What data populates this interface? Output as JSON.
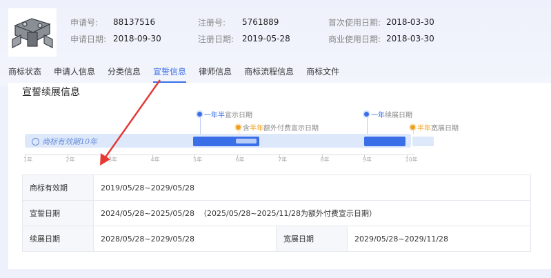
{
  "header": {
    "meta": [
      [
        {
          "k": "申请号:",
          "v": "88137516"
        },
        {
          "k": "申请日期:",
          "v": "2018-09-30"
        }
      ],
      [
        {
          "k": "注册号:",
          "v": "5761889"
        },
        {
          "k": "注册日期:",
          "v": "2019-05-28"
        }
      ],
      [
        {
          "k": "首次使用日期:",
          "v": "2018-03-30"
        },
        {
          "k": "商业使用日期:",
          "v": "2018-03-30"
        }
      ]
    ]
  },
  "tabs": [
    "商标状态",
    "申请人信息",
    "分类信息",
    "宣誓信息",
    "律师信息",
    "商标流程信息",
    "商标文件"
  ],
  "active_tab": "宣誓信息",
  "section_title": "宣誓续展信息",
  "timeline": {
    "track_label": "商标有效期10年",
    "annotations": {
      "a1_hl": "一年半",
      "a1_rest": "宣示日期",
      "a2_pre": "含",
      "a2_hl": "半年",
      "a2_rest": "额外付费宣示日期",
      "a3_hl": "一年",
      "a3_rest": "续展日期",
      "a4_hl": "半年",
      "a4_rest": "宽展日期"
    },
    "ticks": [
      "1年",
      "2年",
      "3年",
      "4年",
      "5年",
      "6年",
      "7年",
      "8年",
      "9年",
      "10年"
    ],
    "colors": {
      "blue": "#3b6fe8",
      "orange": "#f0a020",
      "track": "#dde8fb"
    }
  },
  "table": {
    "r1_label": "商标有效期",
    "r1_value": "2019/05/28~2029/05/28",
    "r2_label": "宣誓日期",
    "r2_value": "2024/05/28~2025/05/28  （2025/05/28~2025/11/28为额外付费宣示日期）",
    "r3_label": "续展日期",
    "r3_value": "2028/05/28~2029/05/28",
    "r3_label2": "宽展日期",
    "r3_value2": "2029/05/28~2029/11/28"
  }
}
